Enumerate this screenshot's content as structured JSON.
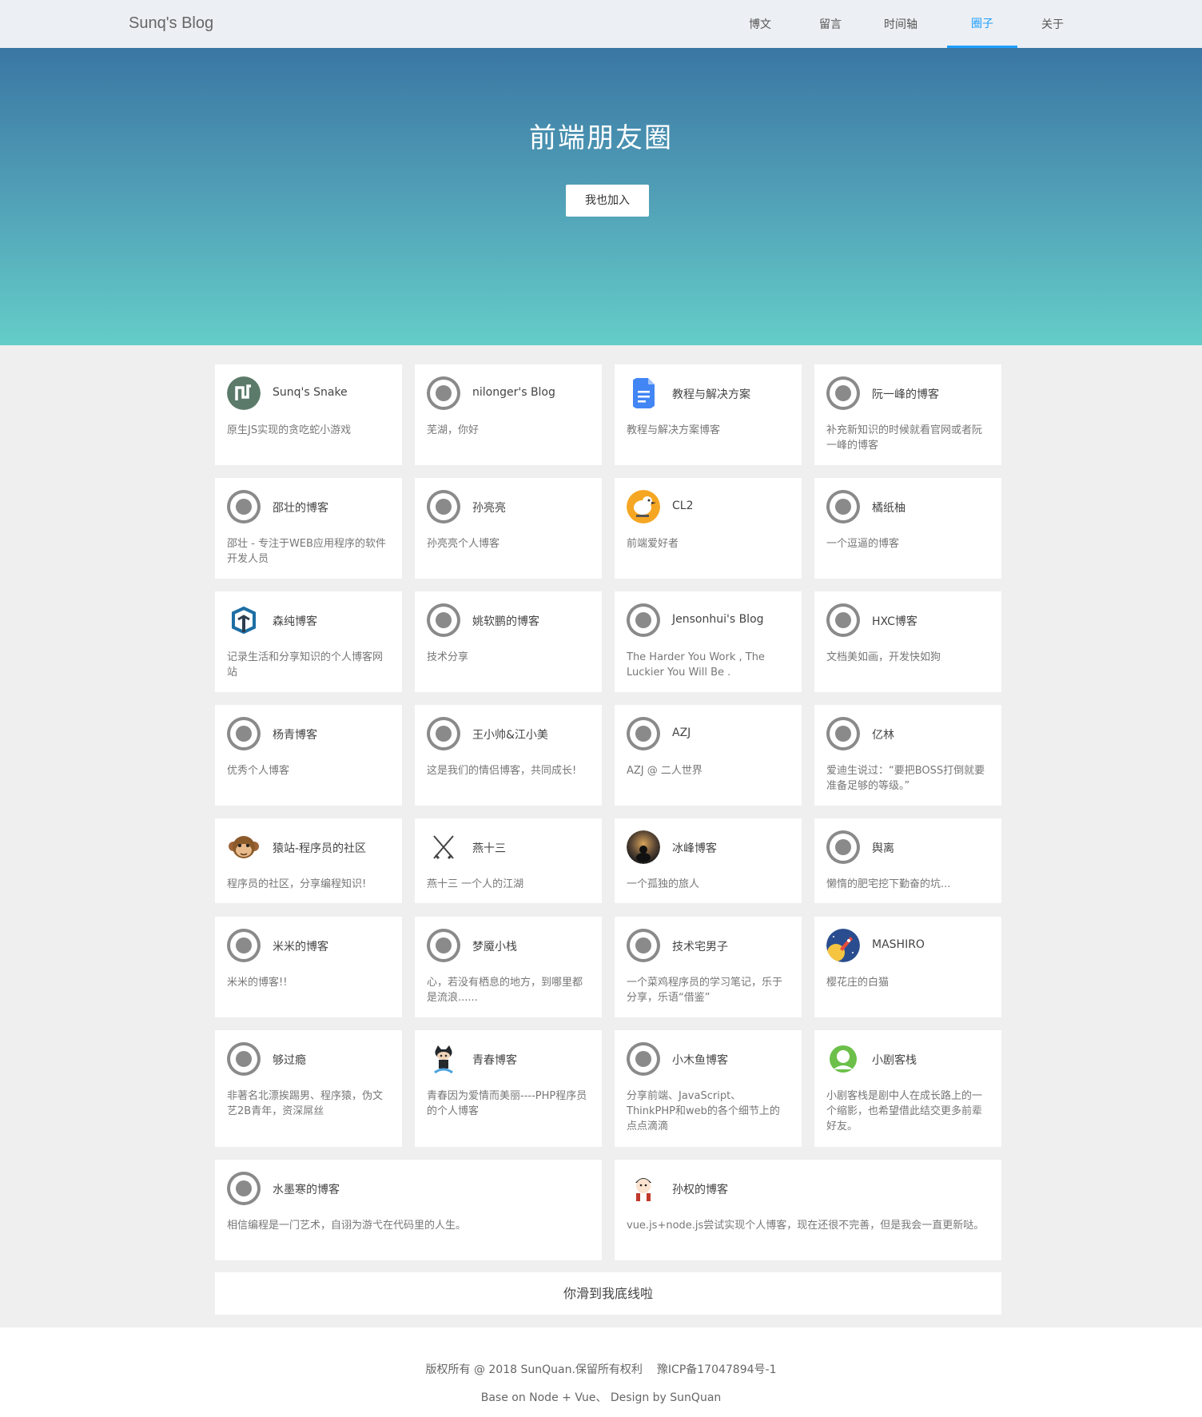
{
  "header": {
    "brand": "Sunq's Blog",
    "nav": [
      {
        "label": "博文"
      },
      {
        "label": "留言"
      },
      {
        "label": "时间轴"
      },
      {
        "label": "圈子",
        "active": true
      },
      {
        "label": "关于"
      }
    ]
  },
  "hero": {
    "title": "前端朋友圈",
    "join_label": "我也加入"
  },
  "friends": [
    {
      "name": "Sunq's Snake",
      "desc": "原生JS实现的贪吃蛇小游戏",
      "icon": "snake-logo-icon"
    },
    {
      "name": "nilonger's Blog",
      "desc": "芜湖，你好",
      "icon": "default-avatar-icon"
    },
    {
      "name": "教程与解决方案",
      "desc": "教程与解决方案博客",
      "icon": "google-docs-icon"
    },
    {
      "name": "阮一峰的博客",
      "desc": "补充新知识的时候就看官网或者阮一峰的博客",
      "icon": "default-avatar-icon"
    },
    {
      "name": "邵壮的博客",
      "desc": "邵壮 - 专注于WEB应用程序的软件开发人员",
      "icon": "default-avatar-icon"
    },
    {
      "name": "孙亮亮",
      "desc": "孙亮亮个人博客",
      "icon": "default-avatar-icon"
    },
    {
      "name": "CL2",
      "desc": "前端爱好者",
      "icon": "duck-avatar-icon"
    },
    {
      "name": "橘纸柚",
      "desc": "一个逗逼的博客",
      "icon": "default-avatar-icon"
    },
    {
      "name": "森纯博客",
      "desc": "记录生活和分享知识的个人博客网站",
      "icon": "cube-logo-icon"
    },
    {
      "name": "姚软鹏的博客",
      "desc": "技术分享",
      "icon": "default-avatar-icon"
    },
    {
      "name": "Jensonhui's Blog",
      "desc": "The Harder You Work , The Luckier You Will Be .",
      "icon": "default-avatar-icon"
    },
    {
      "name": "HXC博客",
      "desc": "文档美如画，开发快如狗",
      "icon": "default-avatar-icon"
    },
    {
      "name": "杨青博客",
      "desc": "优秀个人博客",
      "icon": "default-avatar-icon"
    },
    {
      "name": "王小帅&江小美",
      "desc": "这是我们的情侣博客，共同成长!",
      "icon": "default-avatar-icon"
    },
    {
      "name": "AZJ",
      "desc": "AZJ @ 二人世界",
      "icon": "default-avatar-icon"
    },
    {
      "name": "亿林",
      "desc": "爱迪生说过：“要把BOSS打倒就要准备足够的等级。”",
      "icon": "default-avatar-icon"
    },
    {
      "name": "猿站-程序员的社区",
      "desc": "程序员的社区，分享编程知识!",
      "icon": "monkey-avatar-icon"
    },
    {
      "name": "燕十三",
      "desc": "燕十三 一个人的江湖",
      "icon": "crossed-swords-icon"
    },
    {
      "name": "冰峰博客",
      "desc": "一个孤独的旅人",
      "icon": "photo-avatar-icon"
    },
    {
      "name": "舆离",
      "desc": "懒惰的肥宅挖下勤奋的坑...",
      "icon": "default-avatar-icon"
    },
    {
      "name": "米米的博客",
      "desc": "米米的博客!!",
      "icon": "default-avatar-icon"
    },
    {
      "name": "梦魇小栈",
      "desc": "心，若没有栖息的地方，到哪里都是流浪......",
      "icon": "default-avatar-icon"
    },
    {
      "name": "技术宅男子",
      "desc": "一个菜鸡程序员的学习笔记，乐于分享，乐语“借鉴”",
      "icon": "default-avatar-icon"
    },
    {
      "name": "MASHIRO",
      "desc": "樱花庄的白猫",
      "icon": "rocket-avatar-icon"
    },
    {
      "name": "够过瘾",
      "desc": "非著名北漂挨踢男、程序猿，伪文艺2B青年，资深屌丝",
      "icon": "default-avatar-icon"
    },
    {
      "name": "青春博客",
      "desc": "青春因为爱情而美丽----PHP程序员的个人博客",
      "icon": "octocat-avatar-icon"
    },
    {
      "name": "小木鱼博客",
      "desc": "分享前端、JavaScript、ThinkPHP和web的各个细节上的点点滴滴",
      "icon": "default-avatar-icon"
    },
    {
      "name": "小剧客栈",
      "desc": "小剧客栈是剧中人在成长路上的一个缩影，也希望借此结交更多前辈好友。",
      "icon": "green-ring-avatar-icon"
    },
    {
      "name": "水墨寒的博客",
      "desc": "相信编程是一门艺术，自诩为游弋在代码里的人生。",
      "icon": "default-avatar-icon"
    },
    {
      "name": "孙权的博客",
      "desc": "vue.js+node.js尝试实现个人博客，现在还很不完善，但是我会一直更新哒。",
      "icon": "cartoon-avatar-icon"
    }
  ],
  "end_message": "你滑到我底线啦",
  "footer": {
    "copyright": "版权所有 @ 2018 SunQuan.保留所有权利",
    "icp": "豫ICP备17047894号-1",
    "credits": "Base on Node + Vue、 Design by SunQuan"
  },
  "colors": {
    "accent": "#1e9fff",
    "hero_top": "#3a77a3",
    "hero_bottom": "#64cdc8",
    "page_bg": "#efefef"
  }
}
